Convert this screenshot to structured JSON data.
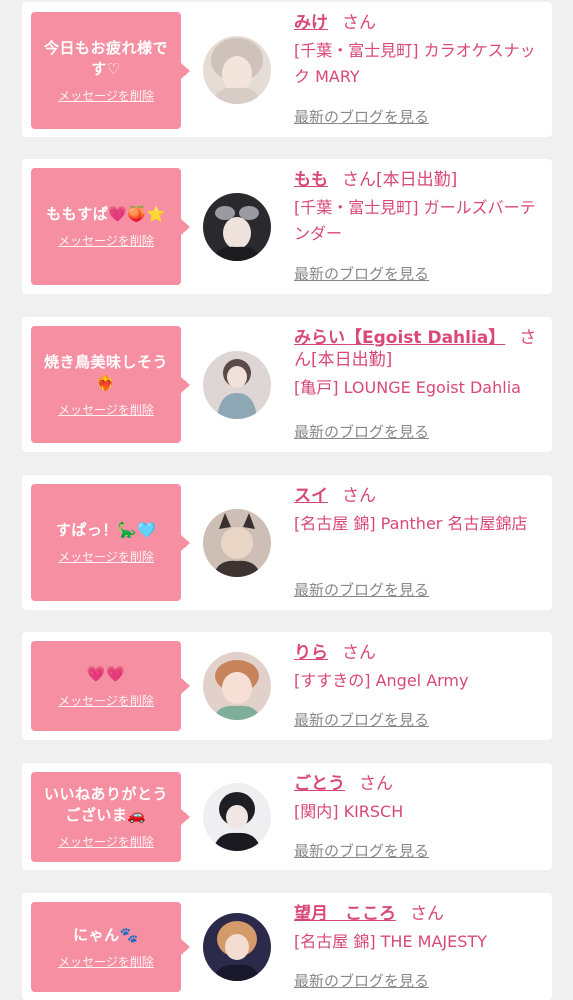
{
  "colors": {
    "accent": "#f58fa1",
    "link": "#d94876",
    "muted": "#888888",
    "background": "#f0f0f0"
  },
  "entries": [
    {
      "message": "今日もお疲れ様です♡",
      "delete_label": "メッセージを削除",
      "name": "みけ",
      "san": "さん",
      "shop": "[千葉・富士見町] カラオケスナック MARY",
      "blog_label": "最新のブログを見る"
    },
    {
      "message": "ももすぱ💗🍑⭐",
      "delete_label": "メッセージを削除",
      "name": "もも",
      "san": "さん[本日出勤]",
      "shop": "[千葉・富士見町] ガールズバーテンダー",
      "blog_label": "最新のブログを見る"
    },
    {
      "message": "焼き鳥美味しそう❤️‍🔥",
      "delete_label": "メッセージを削除",
      "name": "みらい【Egoist Dahlia】",
      "san": "さん[本日出勤]",
      "shop": "[亀戸] LOUNGE Egoist Dahlia",
      "blog_label": "最新のブログを見る"
    },
    {
      "message": "すぱっ！🦕🩵",
      "delete_label": "メッセージを削除",
      "name": "スイ",
      "san": "さん",
      "shop": "[名古屋 錦] Panther 名古屋錦店",
      "blog_label": "最新のブログを見る"
    },
    {
      "message": "💗💗",
      "delete_label": "メッセージを削除",
      "name": "りら",
      "san": "さん",
      "shop": "[すすきの] Angel Army",
      "blog_label": "最新のブログを見る"
    },
    {
      "message": "いいねありがとうございま🚗",
      "delete_label": "メッセージを削除",
      "name": "ごとう",
      "san": "さん",
      "shop": "[関内] KIRSCH",
      "blog_label": "最新のブログを見る"
    },
    {
      "message": "にゃん🐾",
      "delete_label": "メッセージを削除",
      "name": "望月　こころ",
      "san": "さん",
      "shop": "[名古屋 錦] THE MAJESTY",
      "blog_label": "最新のブログを見る"
    }
  ]
}
